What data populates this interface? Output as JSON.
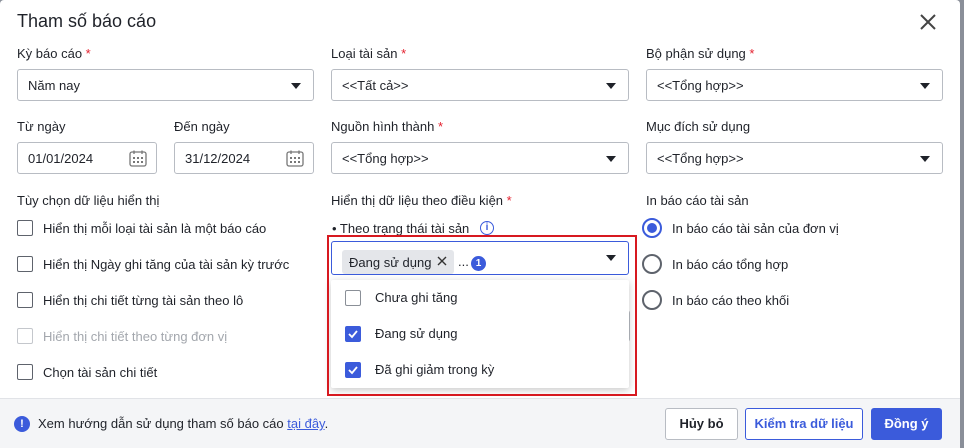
{
  "dialog": {
    "title": "Tham số báo cáo"
  },
  "fields": {
    "ky_bao_cao": {
      "label": "Kỳ báo cáo",
      "required": "*",
      "value": "Năm nay"
    },
    "loai_tai_san": {
      "label": "Loại tài sản",
      "required": "*",
      "value": "<<Tất cả>>"
    },
    "bo_phan": {
      "label": "Bộ phận sử dụng",
      "required": "*",
      "value": "<<Tổng hợp>>"
    },
    "tu_ngay": {
      "label": "Từ ngày",
      "value": "01/01/2024"
    },
    "den_ngay": {
      "label": "Đến ngày",
      "value": "31/12/2024"
    },
    "nguon": {
      "label": "Nguồn hình thành",
      "required": "*",
      "value": "<<Tổng hợp>>"
    },
    "muc_dich": {
      "label": "Mục đích sử dụng",
      "value": "<<Tổng hợp>>"
    }
  },
  "options": {
    "label": "Tùy chọn dữ liệu hiển thị",
    "items": [
      {
        "label": "Hiển thị mỗi loại tài sản là một báo cáo",
        "checked": false,
        "disabled": false
      },
      {
        "label": "Hiển thị Ngày ghi tăng của tài sản kỳ trước",
        "checked": false,
        "disabled": false
      },
      {
        "label": "Hiển thị chi tiết từng tài sản theo lô",
        "checked": false,
        "disabled": false
      },
      {
        "label": "Hiển thị chi tiết theo từng đơn vị",
        "checked": false,
        "disabled": true
      },
      {
        "label": "Chọn tài sản chi tiết",
        "checked": false,
        "disabled": false
      }
    ]
  },
  "condition": {
    "label": "Hiển thị dữ liệu theo điều kiện",
    "required": "*",
    "bullet": "• Theo trạng thái tài sản",
    "tag": "Đang sử dụng",
    "more": "...",
    "count": "1",
    "dropdown": [
      {
        "label": "Chưa ghi tăng",
        "checked": false
      },
      {
        "label": "Đang sử dụng",
        "checked": true
      },
      {
        "label": "Đã ghi giảm trong kỳ",
        "checked": true
      }
    ]
  },
  "print": {
    "label": "In báo cáo tài sản",
    "items": [
      {
        "label": "In báo cáo tài sản của đơn vị",
        "selected": true
      },
      {
        "label": "In báo cáo tổng hợp",
        "selected": false
      },
      {
        "label": "In báo cáo theo khối",
        "selected": false
      }
    ]
  },
  "footer": {
    "help_text": "Xem hướng dẫn sử dụng tham số báo cáo ",
    "help_link": "tại đây",
    "help_end": ".",
    "cancel": "Hủy bỏ",
    "check": "Kiểm tra dữ liệu",
    "ok": "Đồng ý"
  },
  "colors": {
    "accent": "#3b5bdb",
    "required": "#e4202e",
    "highlight": "#d71920"
  }
}
